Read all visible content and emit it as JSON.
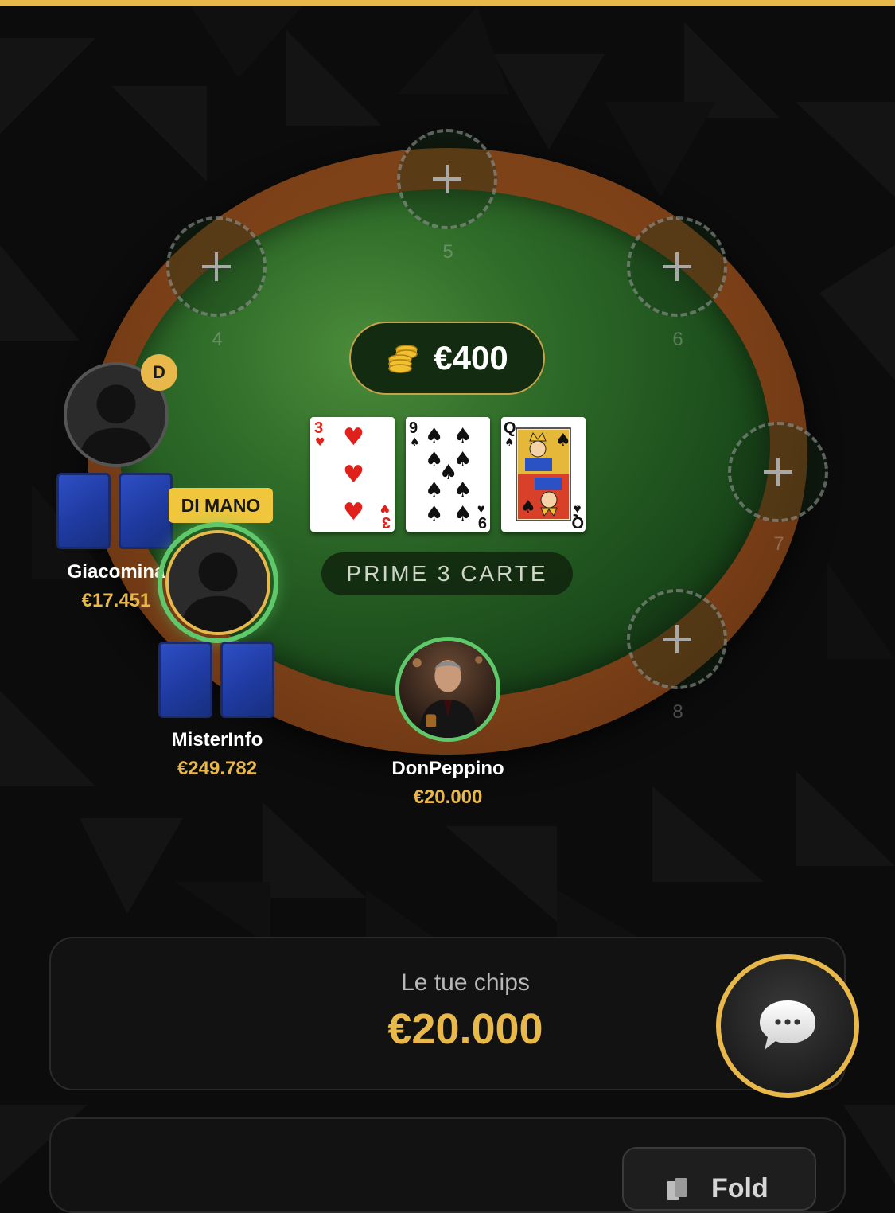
{
  "table": {
    "pot_amount": "€400",
    "phase_label": "PRIME 3 CARTE",
    "community_cards": [
      {
        "rank": "3",
        "suit": "hearts"
      },
      {
        "rank": "9",
        "suit": "spades"
      },
      {
        "rank": "Q",
        "suit": "spades"
      }
    ],
    "empty_seats": [
      "4",
      "5",
      "6",
      "7",
      "8"
    ]
  },
  "players": [
    {
      "name": "Giacomina",
      "chips": "€17.451",
      "badge": "D"
    },
    {
      "name": "MisterInfo",
      "chips": "€249.782",
      "badge": "DI MANO"
    },
    {
      "name": "DonPeppino",
      "chips": "€20.000"
    }
  ],
  "my_chips": {
    "label": "Le tue chips",
    "value": "€20.000"
  },
  "actions": {
    "fold_label": "Fold"
  },
  "colors": {
    "accent": "#e8b84a",
    "felt": "#2f6c29",
    "rim": "#7a3f17",
    "turn_ring": "#5fc86a",
    "card_back": "#2e4fc4"
  },
  "icons": [
    "plus-icon",
    "coins-icon",
    "chat-bubble-icon",
    "fold-icon",
    "user-silhouette-icon"
  ]
}
